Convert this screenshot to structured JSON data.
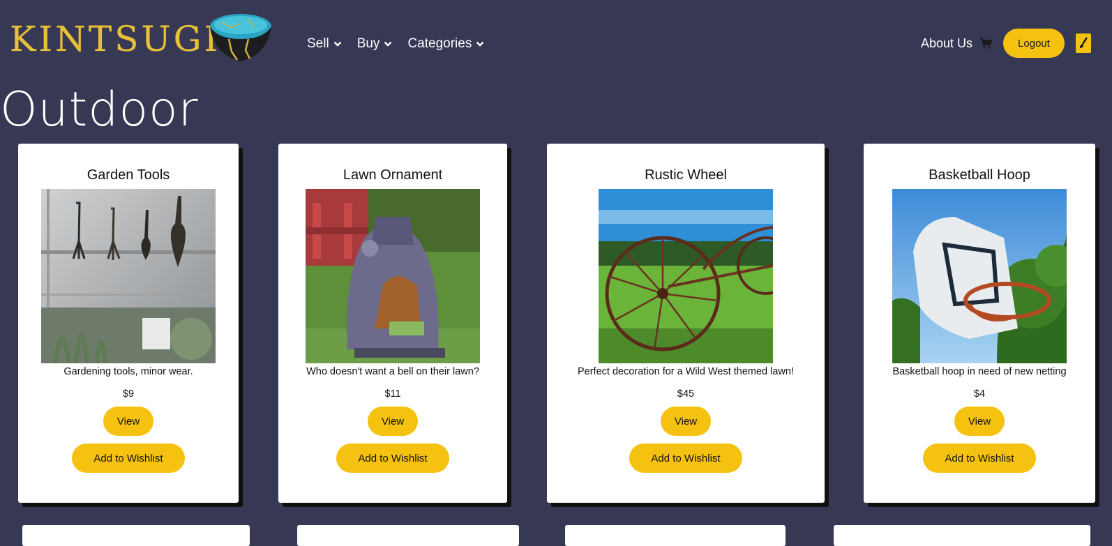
{
  "brand": {
    "name": "KINTSUGI"
  },
  "nav": {
    "menus": [
      {
        "label": "Sell",
        "icon": "chevron-down-icon"
      },
      {
        "label": "Buy",
        "icon": "chevron-down-icon"
      },
      {
        "label": "Categories",
        "icon": "chevron-down-icon"
      }
    ],
    "about_label": "About Us",
    "cart_icon": "cart-icon",
    "logout_label": "Logout",
    "theme_icon": "paintbrush-icon"
  },
  "page": {
    "title": "Outdoor"
  },
  "products": [
    {
      "title": "Garden Tools",
      "description": "Gardening tools, minor wear.",
      "price": "$9",
      "view_label": "View",
      "wishlist_label": "Add to Wishlist"
    },
    {
      "title": "Lawn Ornament",
      "description": "Who doesn't want a bell on their lawn?",
      "price": "$11",
      "view_label": "View",
      "wishlist_label": "Add to Wishlist"
    },
    {
      "title": "Rustic Wheel",
      "description": "Perfect decoration for a Wild West themed lawn!",
      "price": "$45",
      "view_label": "View",
      "wishlist_label": "Add to Wishlist"
    },
    {
      "title": "Basketball Hoop",
      "description": "Basketball hoop in need of new netting",
      "price": "$4",
      "view_label": "View",
      "wishlist_label": "Add to Wishlist"
    }
  ],
  "colors": {
    "background": "#373854",
    "accent": "#f5c211",
    "logo_gold": "#e6c13c",
    "card": "#ffffff"
  }
}
